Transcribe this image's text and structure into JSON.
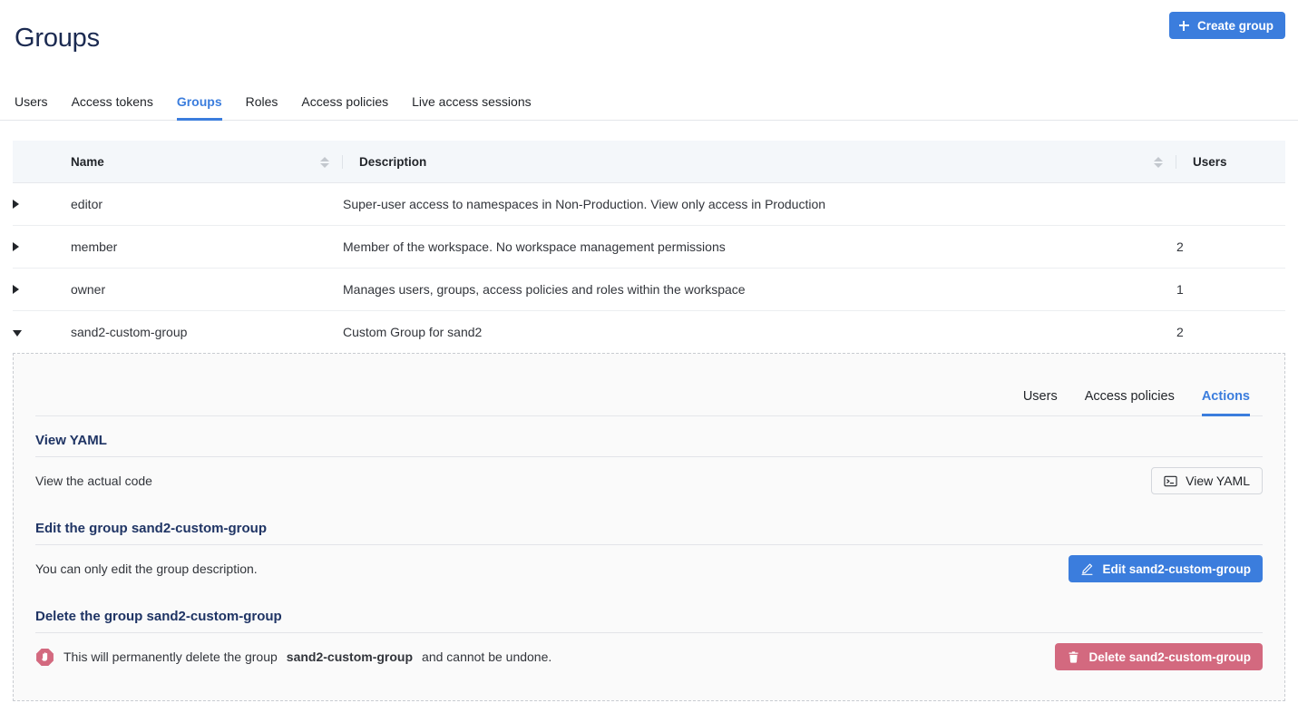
{
  "header": {
    "title": "Groups",
    "create_button": {
      "label": "Create group",
      "icon": "plus-icon"
    }
  },
  "tabs": [
    {
      "label": "Users",
      "active": false
    },
    {
      "label": "Access tokens",
      "active": false
    },
    {
      "label": "Groups",
      "active": true
    },
    {
      "label": "Roles",
      "active": false
    },
    {
      "label": "Access policies",
      "active": false
    },
    {
      "label": "Live access sessions",
      "active": false
    }
  ],
  "table": {
    "columns": [
      "Name",
      "Description",
      "Users"
    ],
    "rows": [
      {
        "name": "editor",
        "description": "Super-user access to namespaces in Non-Production. View only access in Production",
        "users": "",
        "expanded": false
      },
      {
        "name": "member",
        "description": "Member of the workspace. No workspace management permissions",
        "users": "2",
        "expanded": false
      },
      {
        "name": "owner",
        "description": "Manages users, groups, access policies and roles within the workspace",
        "users": "1",
        "expanded": false
      },
      {
        "name": "sand2-custom-group",
        "description": "Custom Group for sand2",
        "users": "2",
        "expanded": true
      }
    ]
  },
  "detail": {
    "tabs": [
      {
        "label": "Users",
        "active": false
      },
      {
        "label": "Access policies",
        "active": false
      },
      {
        "label": "Actions",
        "active": true
      }
    ],
    "sections": {
      "view_yaml": {
        "heading": "View YAML",
        "text": "View the actual code",
        "button_label": "View YAML",
        "button_icon": "terminal-icon"
      },
      "edit": {
        "heading": "Edit the group sand2-custom-group",
        "text": "You can only edit the group description.",
        "button_label": "Edit sand2-custom-group",
        "button_icon": "pencil-icon"
      },
      "delete": {
        "heading": "Delete the group sand2-custom-group",
        "text_before": "This will permanently delete the group",
        "text_bold": "sand2-custom-group",
        "text_after": "and cannot be undone.",
        "button_label": "Delete sand2-custom-group",
        "button_icon": "trash-icon",
        "warning_icon": "stop-hand-icon"
      }
    }
  },
  "colors": {
    "accent": "#3b7ddd",
    "title": "#1b2a51",
    "heading": "#1f3464",
    "danger": "#d3697f",
    "header_row_bg": "#f4f7fa",
    "panel_bg": "#fafafa"
  }
}
